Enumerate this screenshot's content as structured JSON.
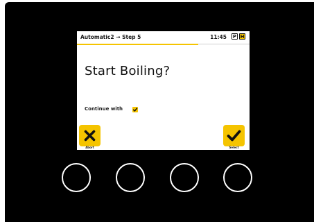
{
  "header": {
    "breadcrumb": "Automatic2 → Step 5",
    "time": "11:45",
    "mode_p": "P",
    "mode_h": "H"
  },
  "dialog": {
    "question": "Start Boiling?",
    "option_label": "Continue with",
    "option_checked": true
  },
  "softkeys": {
    "left_label": "Abort",
    "left_icon": "close-icon",
    "right_label": "Select",
    "right_icon": "check-icon"
  },
  "hardware_buttons": [
    {
      "name": "hardware-button-1"
    },
    {
      "name": "hardware-button-2"
    },
    {
      "name": "hardware-button-3"
    },
    {
      "name": "hardware-button-4"
    }
  ],
  "colors": {
    "accent": "#f5c400",
    "bezel": "#000000",
    "screen": "#ffffff"
  }
}
